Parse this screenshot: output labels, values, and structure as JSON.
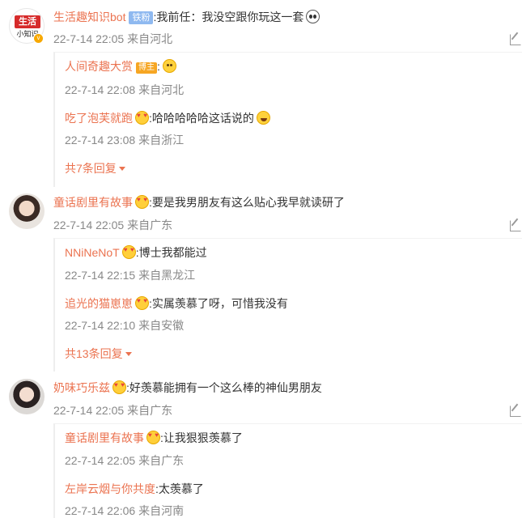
{
  "comments": [
    {
      "name": "生活趣知识bot",
      "badge": "铁粉",
      "text": ":我前任：我没空跟你玩这一套",
      "emoji": "panda-icon",
      "meta": "22-7-14 22:05 来自河北",
      "avatar_top": "生活",
      "avatar_bottom": "小知识",
      "replies": [
        {
          "name": "人间奇趣大赏",
          "badge": "博主",
          "text": ":",
          "emoji": "laugh-icon",
          "meta": "22-7-14 22:08 来自河北"
        },
        {
          "name": "吃了泡芙就跑",
          "badge": "",
          "text": ":哈哈哈哈哈这话说的",
          "emoji": "laugh-icon",
          "meta": "22-7-14 23:08 来自浙江"
        }
      ],
      "more": "共7条回复"
    },
    {
      "name": "童话剧里有故事",
      "text": ":要是我男朋友有这么贴心我早就读研了",
      "meta": "22-7-14 22:05 来自广东",
      "replies": [
        {
          "name": "NNiNeNoT",
          "text": ":博士我都能过",
          "meta": "22-7-14 22:15 来自黑龙江"
        },
        {
          "name": "追光的猫崽崽",
          "text": ":实属羡慕了呀，可惜我没有",
          "meta": "22-7-14 22:10 来自安徽"
        }
      ],
      "more": "共13条回复"
    },
    {
      "name": "奶味巧乐兹",
      "text": ":好羡慕能拥有一个这么棒的神仙男朋友",
      "meta": "22-7-14 22:05 来自广东",
      "replies": [
        {
          "name": "童话剧里有故事",
          "text": ":让我狠狠羡慕了",
          "meta": "22-7-14 22:05 来自广东"
        },
        {
          "name": "左岸云烟与你共度",
          "text": ":太羡慕了",
          "meta": "22-7-14 22:06 来自河南"
        }
      ]
    }
  ],
  "colors": {
    "name": "#eb7350",
    "meta": "#888888",
    "text": "#333333",
    "fan_badge": "#8fb9f0",
    "host_badge": "#f6a623"
  }
}
